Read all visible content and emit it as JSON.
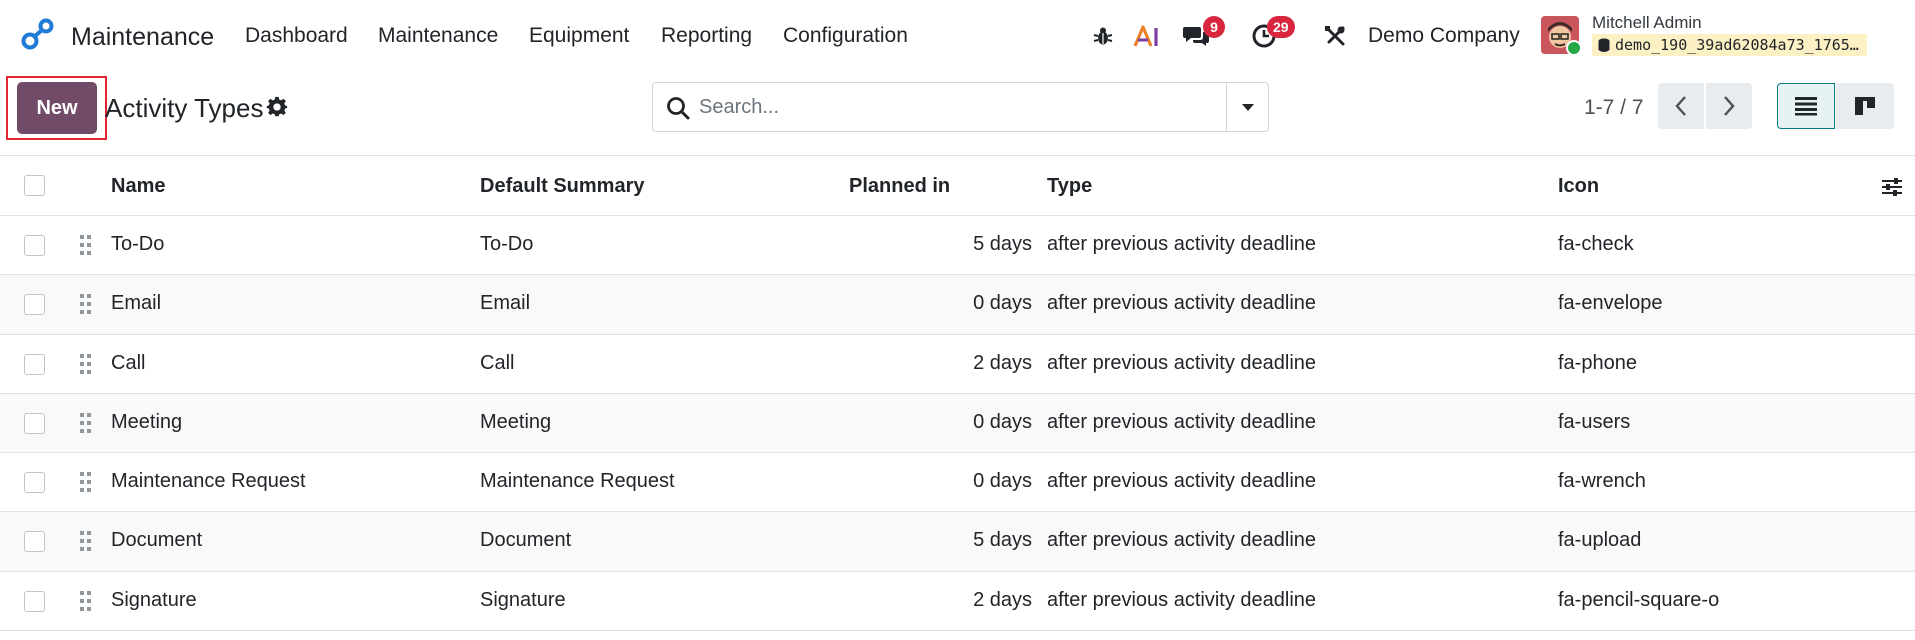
{
  "navbar": {
    "app_name": "Maintenance",
    "menu": [
      "Dashboard",
      "Maintenance",
      "Equipment",
      "Reporting",
      "Configuration"
    ],
    "messages_count": "9",
    "activities_count": "29",
    "company": "Demo Company",
    "user_name": "Mitchell Admin",
    "database": "demo_190_39ad62084a73_1765…"
  },
  "control": {
    "new_label": "New",
    "title": "Activity Types",
    "search_placeholder": "Search...",
    "pager": "1-7 / 7"
  },
  "table": {
    "columns": [
      "Name",
      "Default Summary",
      "Planned in",
      "Type",
      "Icon"
    ],
    "rows": [
      {
        "name": "To-Do",
        "summary": "To-Do",
        "planned": "5 days",
        "type": "after previous activity deadline",
        "icon": "fa-check"
      },
      {
        "name": "Email",
        "summary": "Email",
        "planned": "0 days",
        "type": "after previous activity deadline",
        "icon": "fa-envelope"
      },
      {
        "name": "Call",
        "summary": "Call",
        "planned": "2 days",
        "type": "after previous activity deadline",
        "icon": "fa-phone"
      },
      {
        "name": "Meeting",
        "summary": "Meeting",
        "planned": "0 days",
        "type": "after previous activity deadline",
        "icon": "fa-users"
      },
      {
        "name": "Maintenance Request",
        "summary": "Maintenance Request",
        "planned": "0 days",
        "type": "after previous activity deadline",
        "icon": "fa-wrench"
      },
      {
        "name": "Document",
        "summary": "Document",
        "planned": "5 days",
        "type": "after previous activity deadline",
        "icon": "fa-upload"
      },
      {
        "name": "Signature",
        "summary": "Signature",
        "planned": "2 days",
        "type": "after previous activity deadline",
        "icon": "fa-pencil-square-o"
      }
    ]
  },
  "colors": {
    "brand": "#714b67",
    "accent": "#017e84",
    "badge": "#d7263d",
    "highlight": "#e0262e"
  }
}
